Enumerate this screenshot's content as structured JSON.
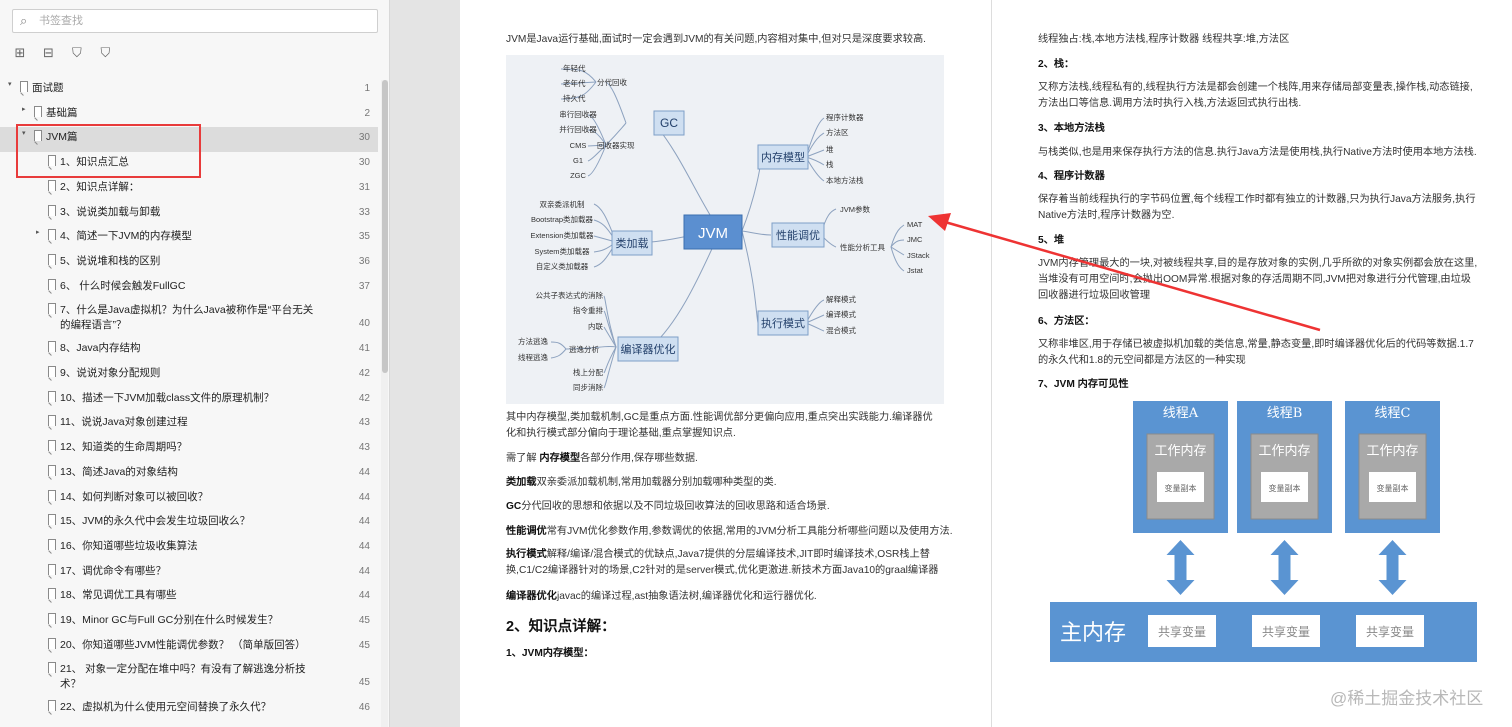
{
  "sidebar": {
    "search_placeholder": "书签查找",
    "tree": [
      {
        "label": "面试题",
        "page": "1",
        "toggle": "▾",
        "level": 0
      },
      {
        "label": "基础篇",
        "page": "2",
        "toggle": "▸",
        "level": 1
      },
      {
        "label": "JVM篇",
        "page": "30",
        "toggle": "▾",
        "level": 1,
        "selected": true
      },
      {
        "label": "1、知识点汇总",
        "page": "30",
        "toggle": "",
        "level": 2
      },
      {
        "label": "2、知识点详解：",
        "page": "31",
        "toggle": "",
        "level": 2
      },
      {
        "label": "3、说说类加载与卸载",
        "page": "33",
        "toggle": "",
        "level": 2
      },
      {
        "label": "4、简述一下JVM的内存模型",
        "page": "35",
        "toggle": "▸",
        "level": 2
      },
      {
        "label": "5、说说堆和栈的区别",
        "page": "36",
        "toggle": "",
        "level": 2
      },
      {
        "label": "6、 什么时候会触发FullGC",
        "page": "37",
        "toggle": "",
        "level": 2
      },
      {
        "label": "7、什么是Java虚拟机？为什么Java被称作是“平台无关的编程语言”？",
        "label2": "的编程语言”？",
        "label1": "7、什么是Java虚拟机？为什么Java被称作是“平台无关",
        "page": "40",
        "toggle": "",
        "level": 2,
        "two": true
      },
      {
        "label": "8、Java内存结构",
        "page": "41",
        "toggle": "",
        "level": 2
      },
      {
        "label": "9、说说对象分配规则",
        "page": "42",
        "toggle": "",
        "level": 2
      },
      {
        "label": "10、描述一下JVM加载class文件的原理机制？",
        "page": "42",
        "toggle": "",
        "level": 2
      },
      {
        "label": "11、说说Java对象创建过程",
        "page": "43",
        "toggle": "",
        "level": 2
      },
      {
        "label": "12、知道类的生命周期吗？",
        "page": "43",
        "toggle": "",
        "level": 2
      },
      {
        "label": "13、简述Java的对象结构",
        "page": "44",
        "toggle": "",
        "level": 2
      },
      {
        "label": "14、如何判断对象可以被回收？",
        "page": "44",
        "toggle": "",
        "level": 2
      },
      {
        "label": "15、JVM的永久代中会发生垃圾回收么？",
        "page": "44",
        "toggle": "",
        "level": 2
      },
      {
        "label": "16、你知道哪些垃圾收集算法",
        "page": "44",
        "toggle": "",
        "level": 2
      },
      {
        "label": "17、调优命令有哪些？",
        "page": "44",
        "toggle": "",
        "level": 2
      },
      {
        "label": "18、常见调优工具有哪些",
        "page": "44",
        "toggle": "",
        "level": 2
      },
      {
        "label": "19、Minor GC与Full GC分别在什么时候发生？",
        "page": "45",
        "toggle": "",
        "level": 2
      },
      {
        "label": "20、你知道哪些JVM性能调优参数？ （简单版回答）",
        "page": "45",
        "toggle": "",
        "level": 2
      },
      {
        "label": "21、 对象一定分配在堆中吗？有没有了解逃逸分析技术？",
        "label1": "21、 对象一定分配在堆中吗？有没有了解逃逸分析技",
        "label2": "术？",
        "page": "45",
        "toggle": "",
        "level": 2,
        "two": true
      },
      {
        "label": "22、虚拟机为什么使用元空间替换了永久代？",
        "page": "46",
        "toggle": "",
        "level": 2
      }
    ]
  },
  "page_left": {
    "intro": "JVM是Java运行基础,面试时一定会遇到JVM的有关问题,内容相对集中,但对只是深度要求较高.",
    "mindmap": {
      "center": "JVM",
      "gc": {
        "title": "GC",
        "g1": "分代回收",
        "g1_items": [
          "年轻代",
          "老年代",
          "持久代"
        ],
        "g2": "回收器实现",
        "g2_items": [
          "串行回收器",
          "并行回收器",
          "CMS",
          "G1",
          "ZGC"
        ]
      },
      "classload": {
        "title": "类加载",
        "items": [
          "双亲委派机制",
          "Bootstrap类加载器",
          "Extension类加载器",
          "System类加载器",
          "自定义类加载器"
        ]
      },
      "compile": {
        "title": "编译器优化",
        "items_top": [
          "公共子表达式的消除",
          "指令重排",
          "内联"
        ],
        "escape": "逃逸分析",
        "escape_items": [
          "方法逃逸",
          "线程逃逸"
        ],
        "items_bottom": [
          "栈上分配",
          "同步消除"
        ]
      },
      "memory": {
        "title": "内存模型",
        "items": [
          "程序计数器",
          "方法区",
          "堆",
          "栈",
          "本地方法栈"
        ]
      },
      "perf": {
        "title": "性能调优",
        "param": "JVM参数",
        "tools": "性能分析工具",
        "tool_items": [
          "MAT",
          "JMC",
          "JStack",
          "Jstat"
        ]
      },
      "exec": {
        "title": "执行模式",
        "items": [
          "解释模式",
          "编译模式",
          "混合模式"
        ]
      }
    },
    "para1": "其中内存模型,类加载机制,GC是重点方面.性能调优部分更偏向应用,重点突出实践能力.编译器优化和执行模式部分偏向于理论基础,重点掌握知识点.",
    "para2_pre": "需了解 ",
    "para2_b": "内存模型",
    "para2_post": "各部分作用,保存哪些数据.",
    "para3_b": "类加载",
    "para3_post": "双亲委派加载机制,常用加载器分别加载哪种类型的类.",
    "para4_b": "GC",
    "para4_post": "分代回收的思想和依据以及不同垃圾回收算法的回收思路和适合场景.",
    "para5_b": "性能调优",
    "para5_post": "常有JVM优化参数作用,参数调优的依据,常用的JVM分析工具能分析哪些问题以及使用方法.",
    "para6_b": "执行模式",
    "para6_post": "解释/编译/混合模式的优缺点,Java7提供的分层编译技术,JIT即时编译技术,OSR栈上替换,C1/C2编译器针对的场景,C2针对的是server模式,优化更激进.新技术方面Java10的graal编译器",
    "para7_b": "编译器优化",
    "para7_post": "javac的编译过程,ast抽象语法树,编译器优化和运行器优化.",
    "h2": "2、知识点详解：",
    "h3": "1、JVM内存模型："
  },
  "page_right": {
    "line0": "线程独占:栈,本地方法栈,程序计数器 线程共享:堆,方法区",
    "s2": "2、栈：",
    "s2_text": "又称方法栈,线程私有的,线程执行方法是都会创建一个栈阵,用来存储局部变量表,操作栈,动态链接,方法出口等信息.调用方法时执行入栈,方法返回式执行出栈.",
    "s3": "3、本地方法栈",
    "s3_text": "与栈类似,也是用来保存执行方法的信息.执行Java方法是使用栈,执行Native方法时使用本地方法栈.",
    "s4": "4、程序计数器",
    "s4_text": "保存着当前线程执行的字节码位置,每个线程工作时都有独立的计数器,只为执行Java方法服务,执行Native方法时,程序计数器为空.",
    "s5": "5、堆",
    "s5_text": "JVM内存管理最大的一块,对被线程共享,目的是存放对象的实例,几乎所欲的对象实例都会放在这里,当堆没有可用空间时,会抛出OOM异常.根据对象的存活周期不同,JVM把对象进行分代管理,由垃圾回收器进行垃圾回收管理",
    "s6": "6、方法区：",
    "s6_text": "又称非堆区,用于存储已被虚拟机加载的类信息,常量,静态变量,即时编译器优化后的代码等数据.1.7的永久代和1.8的元空间都是方法区的一种实现",
    "s7": "7、JVM 内存可见性",
    "jmm": {
      "threads": [
        "线程A",
        "线程B",
        "线程C"
      ],
      "work": "工作内存",
      "copy": "变量副本",
      "main": "主内存",
      "shared": "共享变量"
    }
  },
  "watermark": "@稀土掘金技术社区"
}
